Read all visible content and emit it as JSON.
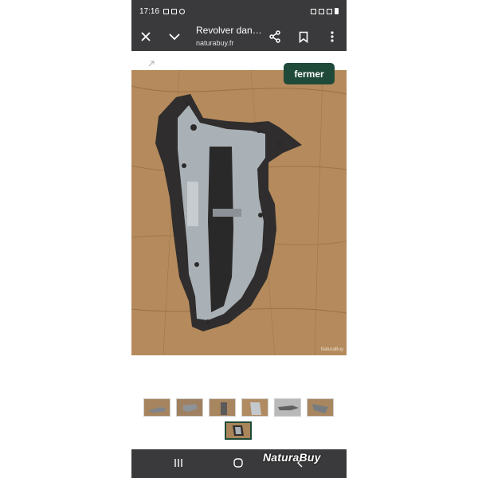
{
  "status_bar": {
    "time": "17:16"
  },
  "app_bar": {
    "page_title": "Revolver dan…",
    "page_url": "naturabuy.fr"
  },
  "content": {
    "close_label": "fermer",
    "photo_watermark": "NaturaBuy",
    "thumbnail_count": 7,
    "active_thumbnail": 7
  },
  "nav_bar": {
    "brand_overlay": "NaturaBuy"
  },
  "icons": {
    "close": "close-icon",
    "collapse": "chevron-down-icon",
    "share": "share-icon",
    "bookmark": "bookmark-icon",
    "menu": "more-vertical-icon",
    "recent": "recent-apps-icon",
    "home": "home-icon"
  },
  "colors": {
    "bars": "#3a3a3c",
    "accent_button": "#1f4a3a"
  }
}
